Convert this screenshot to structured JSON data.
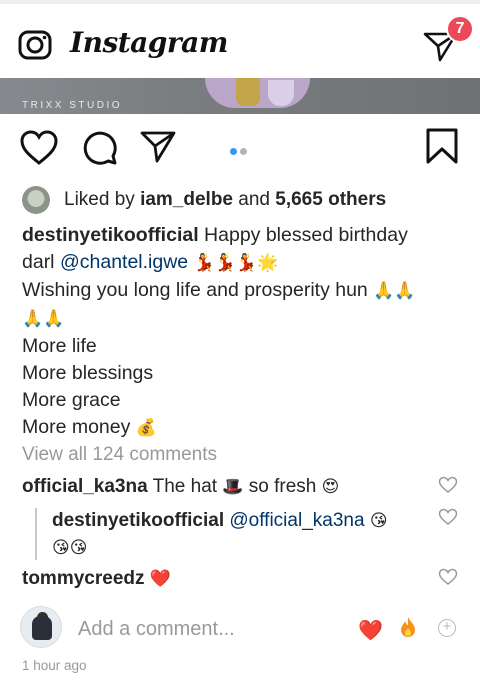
{
  "header": {
    "logo_text": "Instagram",
    "dm_badge": "7",
    "icons": [
      "camera-icon",
      "direct-message-icon"
    ]
  },
  "post": {
    "image_watermark": "TRIXX STUDIO",
    "carousel": {
      "total": 2,
      "active": 1,
      "active_color": "#3897f0"
    },
    "likes": {
      "prefix": "Liked by",
      "user": "iam_delbe",
      "and": "and",
      "count_text": "5,665 others"
    },
    "caption": {
      "username": "destinyetikoofficial",
      "line1_text": "Happy blessed birthday",
      "line2_prefix": "darl",
      "mention": "@chantel.igwe",
      "line2_emoji": "💃💃💃🌟",
      "line3": "Wishing you long life and prosperity hun",
      "line3_emoji": "🙏🙏",
      "line4_emoji": "🙏🙏",
      "line5": "More life",
      "line6": "More blessings",
      "line7": "More grace",
      "line8": "More money",
      "line8_emoji": "💰"
    },
    "view_all": "View all 124 comments",
    "comments": [
      {
        "username": "official_ka3na",
        "text": "The hat",
        "emoji_mid": "🎩",
        "text2": "so fresh",
        "emoji_end": "😍"
      },
      {
        "username": "destinyetikoofficial",
        "mention": "@official_ka3na",
        "emoji_end": "😘",
        "line2_emoji": "😘😘"
      },
      {
        "username": "tommycreedz",
        "emoji_end": "❤️"
      }
    ],
    "composer": {
      "placeholder": "Add a comment...",
      "quick_reactions": [
        "❤️",
        "🔥"
      ],
      "plus": "+"
    },
    "timestamp": "1 hour ago"
  }
}
